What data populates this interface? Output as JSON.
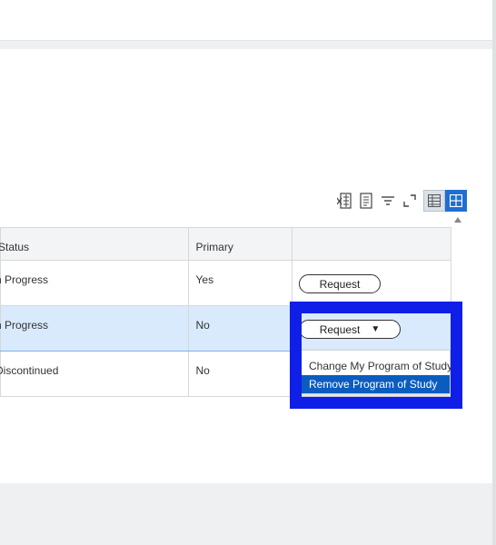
{
  "table": {
    "headers": {
      "status": "Status",
      "primary": "Primary",
      "action": ""
    },
    "rows": [
      {
        "status": "n Progress",
        "primary": "Yes",
        "action": "Request"
      },
      {
        "status": "n Progress",
        "primary": "No",
        "action": "Request"
      },
      {
        "status": "Discontinued",
        "primary": "No",
        "action": ""
      }
    ]
  },
  "request_menu": {
    "caret": "▼",
    "items": [
      "Change My Program of Study",
      "Remove Program of Study"
    ],
    "highlighted_index": 1
  },
  "toolbar": {
    "icons": [
      "export-excel-icon",
      "print-icon",
      "filter-icon",
      "fullscreen-icon",
      "table-view-icon",
      "grid-view-icon"
    ]
  },
  "colors": {
    "highlight": "#0f1fe8",
    "selected_row": "#d9eafc",
    "menu_active": "#0b5cc0",
    "toggle_active": "#1f6fd1"
  }
}
